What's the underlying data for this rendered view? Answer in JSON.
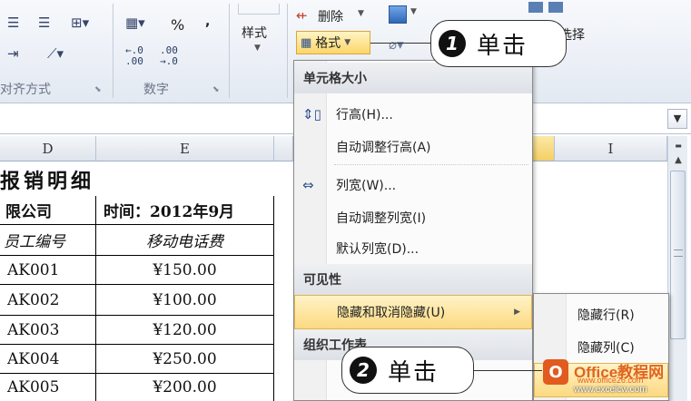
{
  "ribbon": {
    "groups": {
      "alignment_label": "对齐方式",
      "number_label": "数字"
    },
    "percent": "%",
    "comma": ",",
    "dec_increase": ".00",
    "dec_decrease": ".00",
    "dec_increase2": "←.0",
    "dec_decrease2": "→.0",
    "styles_label": "样式",
    "delete_label": "删除",
    "format_label": "格式",
    "select_label": "选择"
  },
  "callouts": {
    "one": {
      "num": "1",
      "text": "单击"
    },
    "two": {
      "num": "2",
      "text": "单击"
    }
  },
  "columns": {
    "d": "D",
    "e": "E",
    "i": "I"
  },
  "sheet": {
    "title": "报销明细",
    "company": "限公司",
    "time": "时间：2012年9月",
    "header_id": "员工编号",
    "header_phone": "移动电话费",
    "rows": [
      {
        "id": "AK001",
        "amount": "¥150.00"
      },
      {
        "id": "AK002",
        "amount": "¥100.00"
      },
      {
        "id": "AK003",
        "amount": "¥120.00"
      },
      {
        "id": "AK004",
        "amount": "¥250.00"
      },
      {
        "id": "AK005",
        "amount": "¥200.00"
      }
    ]
  },
  "menu": {
    "section_cell_size": "单元格大小",
    "row_height": "行高(H)...",
    "autofit_row": "自动调整行高(A)",
    "col_width": "列宽(W)...",
    "autofit_col": "自动调整列宽(I)",
    "default_width": "默认列宽(D)...",
    "section_visibility": "可见性",
    "hide_unhide": "隐藏和取消隐藏(U)",
    "section_organize": "组织工作表"
  },
  "submenu": {
    "hide_rows": "隐藏行(R)",
    "hide_cols": "隐藏列(C)"
  },
  "watermark": {
    "logo": "O",
    "brand": "Office教程网",
    "url": "www.office26.com",
    "url2": "www.excelcw.com"
  },
  "colors": {
    "highlight": "#fcd980",
    "ribbon_bg": "#e3e9f2"
  }
}
